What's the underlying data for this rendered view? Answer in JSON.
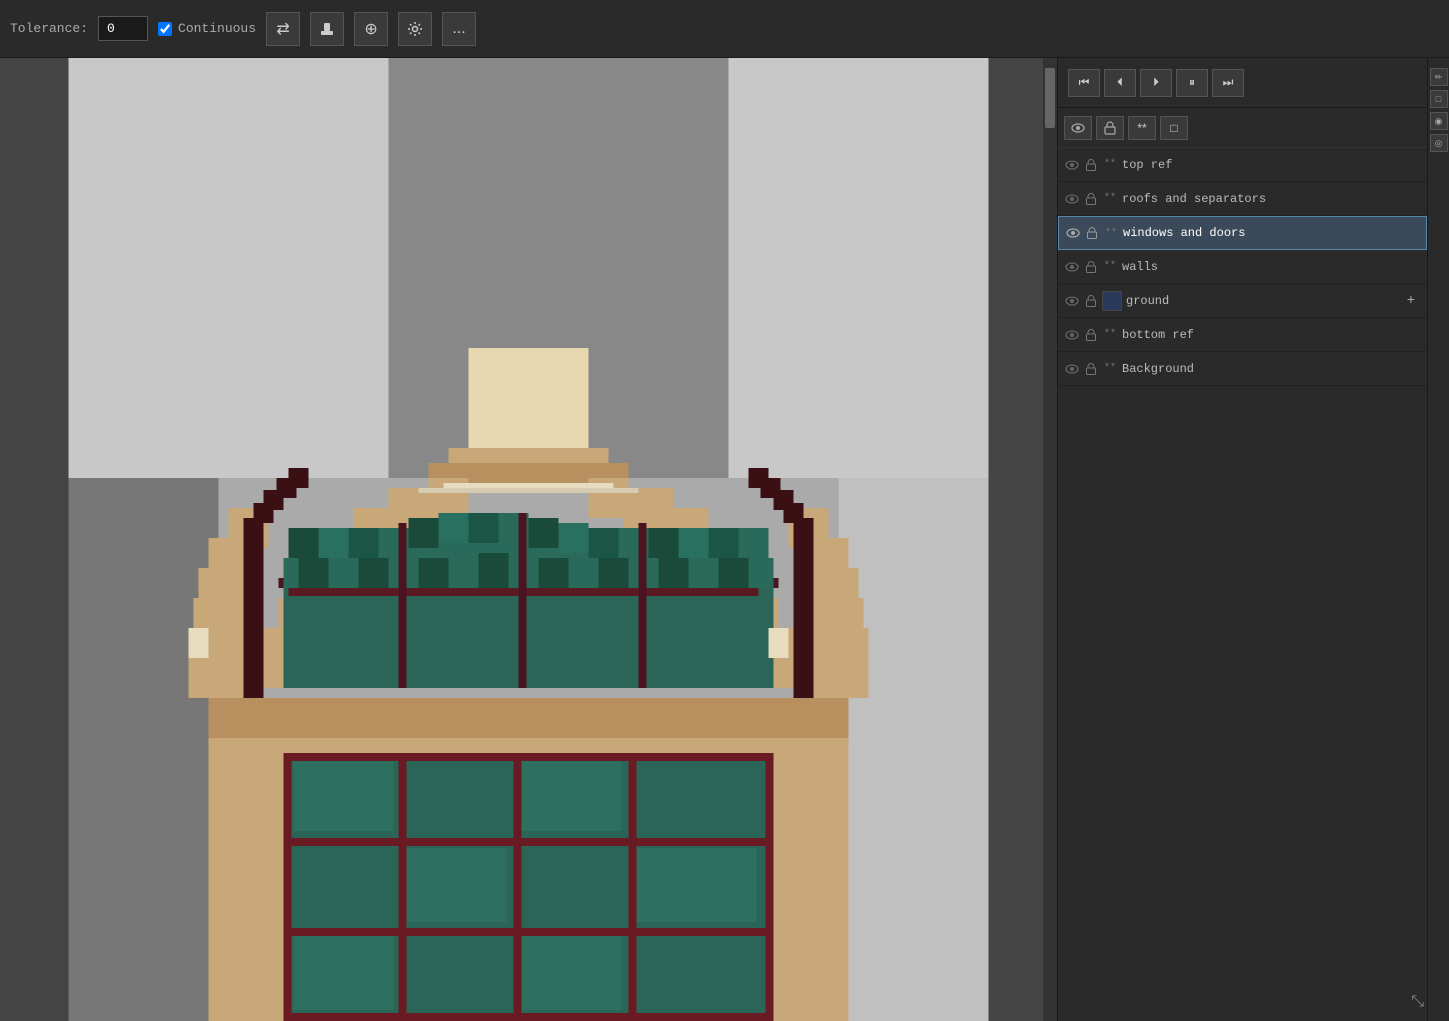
{
  "toolbar": {
    "tolerance_label": "Tolerance:",
    "tolerance_value": "0",
    "continuous_label": "Continuous",
    "continuous_checked": true,
    "btn_transform": "⇄",
    "btn_stamp": "👤",
    "btn_crosshair": "⊕",
    "btn_gear": "⚙",
    "btn_more": "..."
  },
  "timeline": {
    "btn_first": "⏮",
    "btn_prev_frame": "⏴",
    "btn_next_frame": "⏵",
    "btn_pause": "⏸",
    "btn_last": "⏭"
  },
  "layer_controls": {
    "btn_eye": "👁",
    "btn_lock": "🔒",
    "btn_link": "**",
    "btn_square": "□"
  },
  "layers": [
    {
      "id": "top-ref",
      "name": "top ref",
      "visible": false,
      "locked": true,
      "linked": true,
      "active": false,
      "thumb_color": "default"
    },
    {
      "id": "roofs-separators",
      "name": "roofs and separators",
      "visible": false,
      "locked": true,
      "linked": true,
      "active": false,
      "thumb_color": "default"
    },
    {
      "id": "windows-doors",
      "name": "windows and doors",
      "visible": true,
      "locked": true,
      "linked": true,
      "active": true,
      "thumb_color": "default"
    },
    {
      "id": "walls",
      "name": "walls",
      "visible": false,
      "locked": true,
      "linked": true,
      "active": false,
      "thumb_color": "default"
    },
    {
      "id": "ground",
      "name": "ground",
      "visible": false,
      "locked": true,
      "linked": false,
      "active": false,
      "thumb_color": "blue-dark"
    },
    {
      "id": "bottom-ref",
      "name": "bottom ref",
      "visible": false,
      "locked": true,
      "linked": true,
      "active": false,
      "thumb_color": "default"
    },
    {
      "id": "background",
      "name": "Background",
      "visible": false,
      "locked": true,
      "linked": true,
      "active": false,
      "thumb_color": "default"
    }
  ],
  "colors": {
    "bg_light": "#c8c8c8",
    "bg_medium": "#aaaaaa",
    "bg_dark": "#888888",
    "active_layer_bg": "#3a4a5a",
    "active_layer_border": "#5588aa"
  }
}
